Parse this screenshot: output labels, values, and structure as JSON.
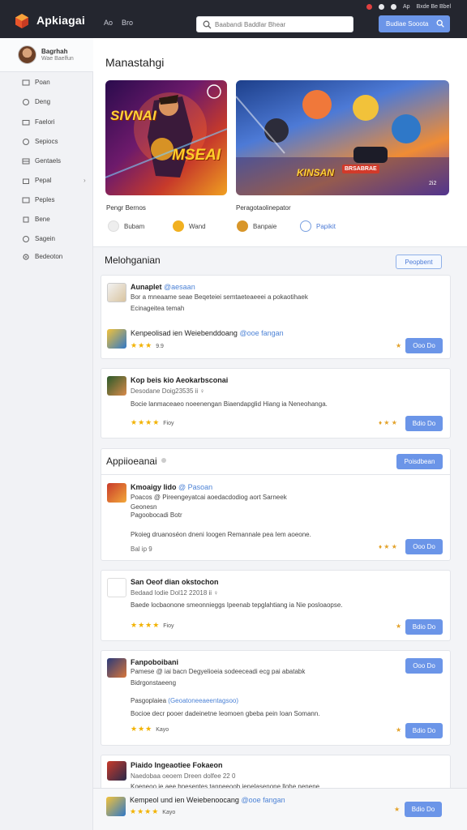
{
  "app": {
    "name": "Apkiagai",
    "nav": [
      "Ao",
      "Bro"
    ]
  },
  "status": {
    "icons": [
      "notification-icon",
      "user-icon",
      "globe-icon"
    ],
    "labels": [
      "Ap",
      "Bxde Be Bbel"
    ]
  },
  "search": {
    "placeholder": "Baabandi Baddlar Bhear"
  },
  "topbar": {
    "cta_label": "Budiae Sooota"
  },
  "sidebar": {
    "profile": {
      "name": "Bagrhah",
      "sub": "Wae Baelfun"
    },
    "items": [
      {
        "label": "Poan",
        "icon": "home-icon"
      },
      {
        "label": "Deng",
        "icon": "circle-icon"
      },
      {
        "label": "Faelori",
        "icon": "folder-icon"
      },
      {
        "label": "Sepiocs",
        "icon": "circle-icon"
      },
      {
        "label": "Gentaels",
        "icon": "list-icon"
      },
      {
        "label": "Pepal",
        "icon": "bag-icon"
      },
      {
        "label": "Peples",
        "icon": "people-icon"
      },
      {
        "label": "Bene",
        "icon": "book-icon"
      },
      {
        "label": "Sagein",
        "icon": "circle-icon"
      },
      {
        "label": "Bedeoton",
        "icon": "gear-icon"
      }
    ]
  },
  "hero": {
    "title": "Manastahgi",
    "left_banner": {
      "line1": "SIVNAI",
      "line2": "MSEAI",
      "caption": "Pengr Bernos"
    },
    "right_banner": {
      "logo": "KINSAN",
      "badge": "BRSABRAE",
      "count": "2i2",
      "caption": "Peragotaolinepator"
    },
    "mini_items": [
      {
        "label": "Bubam",
        "icon": "user-icon"
      },
      {
        "label": "Wand",
        "icon": "smile-icon"
      },
      {
        "label": "Banpaie",
        "icon": "emoji-icon"
      },
      {
        "label": "Papikit",
        "icon": "link-icon"
      }
    ]
  },
  "section1": {
    "title": "Melohganian",
    "action": "Peopbent",
    "cards": [
      {
        "title": "Aunaplet",
        "tag": "@aesaan",
        "line1": "Bor a mneaame seae Beqeteiei semtaeteaeeei a pokaotihaek",
        "line2": "Ecinageitea temah",
        "line3_main": "Kenpeolisad ien Weiebenddoang",
        "line3_tag": "@ooe fangan",
        "rating": "★★★",
        "rating_num": "9.9",
        "button": "Ooo Do"
      },
      {
        "title": "Kop beis kio Aeokarbsconai",
        "line1": "Desodane  Doig23535 ii ♀",
        "line2": "Bocie lanmaceaeo noeenengan Biaendapglid Hiang ia Neneohanga.",
        "rating": "★★★★",
        "rating_num": "Fioy",
        "button": "Bdio Do"
      }
    ]
  },
  "section2": {
    "title": "Appiioeanai",
    "action": "Poisdbean",
    "cards": [
      {
        "title": "Kmoaigy Iido",
        "tag": "@ Pasoan",
        "line1": "Poacos @ Pireengeyatcai aoedacdodiog aort Sarneek",
        "line2": "Geonesn",
        "line3": "Pagoobocadi Botr",
        "line4": "Pkoieg druanoséon dneni Ioogen Remannale pea Iem aoeone.",
        "meta": "Bal ip 9",
        "button": "Ooo Do"
      },
      {
        "title": "San Oeof dian okstochon",
        "line1": "Bedaad lodie  Dol12 22018 ii ♀",
        "line2": "Baede locbaonone smeonnieggs Ipeenab tepglahtiang ia Nie posloaopse.",
        "rating": "★★★★",
        "rating_num": "Fioy",
        "button": "Bdio Do"
      },
      {
        "title": "Fanpoboibani",
        "line1": "Pamese @ iai bacn Degyelioeia sodeeceadi ecg pai abatabk",
        "line2": "Bidrgonstaeeng",
        "line3_main": "Pasgoplaiea",
        "line3_tag": "(Geoatoneeaeentagsoo)",
        "line4": "Bocioe decr pooer dadeinetne leomoen gbeba pein Ioan Somann.",
        "rating": "★★★",
        "rating_num": "Kayo",
        "top_button": "Ooo Do",
        "button": "Bdio Do"
      },
      {
        "title": "Piaido Ingeaotiee Fokaeon",
        "line1": "Naedobaa oeoem  Dreen dolfee 22 0",
        "line2": "Koeneoo ie aee bnesentes tanneeoob ienelasenone llohe nenene"
      }
    ]
  },
  "bottom_bar": {
    "title_main": "Kempeol und ien Weiebenoocang",
    "title_tag": "@ooe fangan",
    "rating": "★★★★",
    "rating_num": "Kayo",
    "button": "Bdio Do"
  },
  "colors": {
    "accent": "#6b95e8",
    "topbar": "#24262f",
    "star": "#f2b200"
  }
}
